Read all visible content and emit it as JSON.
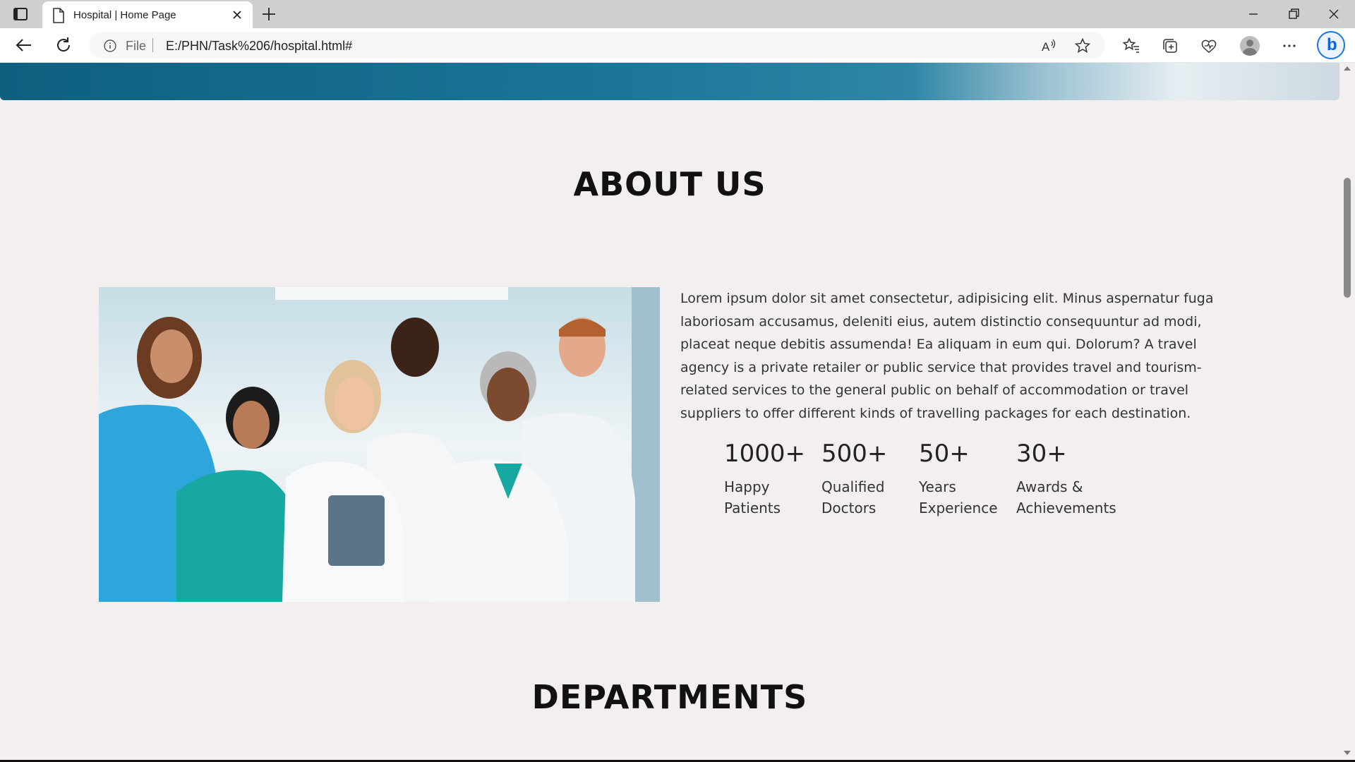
{
  "browser": {
    "tab_title": "Hospital | Home Page",
    "address": {
      "scheme_label": "File",
      "url": "E:/PHN/Task%206/hospital.html#"
    },
    "icons": [
      "tab-actions-icon",
      "page-icon",
      "close-icon",
      "new-tab-icon",
      "minimize-icon",
      "restore-icon",
      "window-close-icon",
      "back-icon",
      "refresh-icon",
      "info-icon",
      "read-aloud-icon",
      "favorite-star-icon",
      "favorites-icon",
      "collections-icon",
      "browser-essentials-icon",
      "profile-avatar",
      "more-options-icon",
      "bing-icon"
    ]
  },
  "about": {
    "title": "ABOUT US",
    "paragraph": "Lorem ipsum dolor sit amet consectetur, adipisicing elit. Minus aspernatur fuga laboriosam accusamus, deleniti eius, autem distinctio consequuntur ad modi, placeat neque debitis assumenda! Ea aliquam in eum qui. Dolorum? A travel agency is a private retailer or public service that provides travel and tourism-related services to the general public on behalf of accommodation or travel suppliers to offer different kinds of travelling packages for each destination.",
    "stats": [
      {
        "number": "1000+",
        "label_line1": "Happy",
        "label_line2": "Patients"
      },
      {
        "number": "500+",
        "label_line1": "Qualified",
        "label_line2": "Doctors"
      },
      {
        "number": "50+",
        "label_line1": "Years",
        "label_line2": "Experience"
      },
      {
        "number": "30+",
        "label_line1": "Awards &",
        "label_line2": "Achievements"
      }
    ]
  },
  "departments": {
    "title": "DEPARTMENTS"
  },
  "colors": {
    "page_bg": "#f3efef",
    "hero_blue": "#1a7597",
    "heading": "#111111"
  }
}
